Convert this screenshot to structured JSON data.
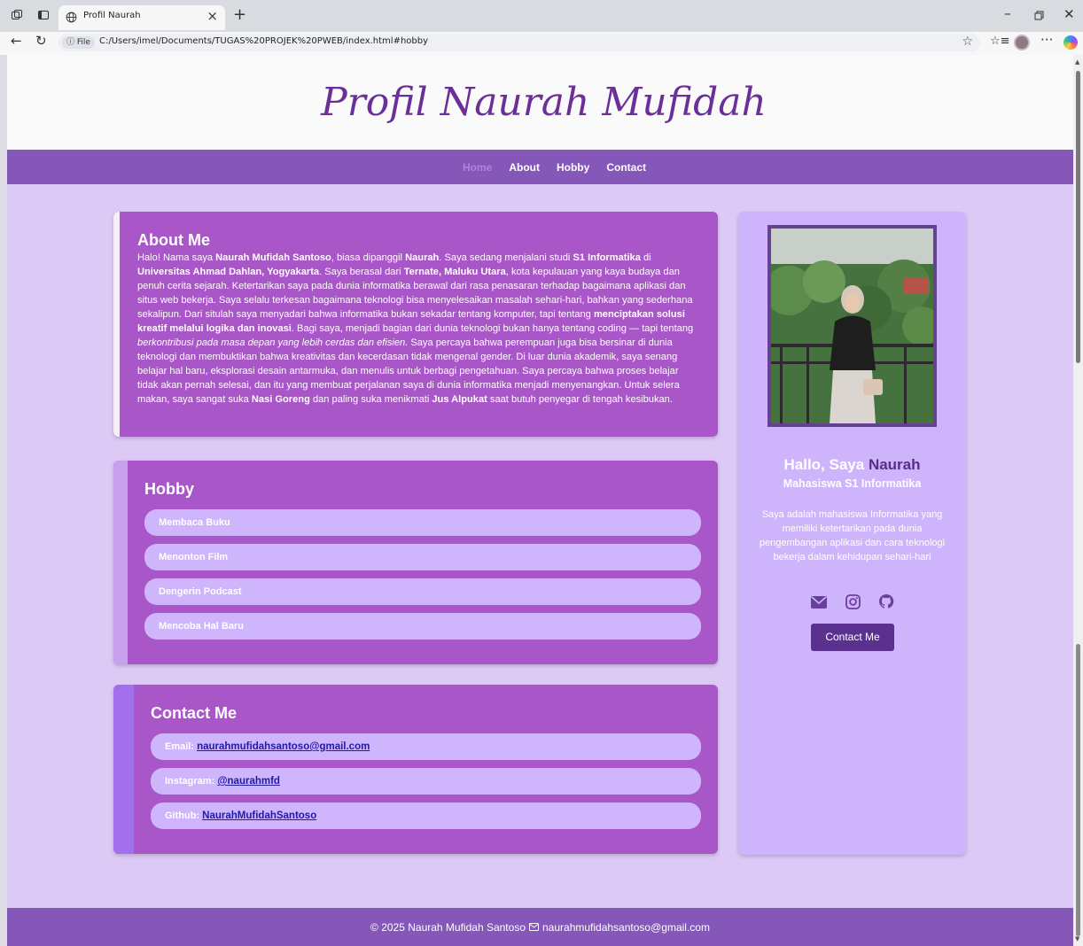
{
  "browser": {
    "tab_title": "Profil Naurah",
    "url_chip": "File",
    "url": "C:/Users/imel/Documents/TUGAS%20PROJEK%20PWEB/index.html#hobby"
  },
  "hero": {
    "title": "Profil Naurah Mufidah"
  },
  "nav": {
    "items": [
      "Home",
      "About",
      "Hobby",
      "Contact"
    ],
    "active": "Home"
  },
  "about": {
    "heading": "About Me",
    "segments": [
      {
        "t": "Halo! Nama saya "
      },
      {
        "t": "Naurah Mufidah Santoso",
        "b": true
      },
      {
        "t": ", biasa dipanggil "
      },
      {
        "t": "Naurah",
        "b": true
      },
      {
        "t": ". Saya sedang menjalani studi "
      },
      {
        "t": "S1 Informatika",
        "b": true
      },
      {
        "t": " di "
      },
      {
        "t": "Universitas Ahmad Dahlan, Yogyakarta",
        "b": true
      },
      {
        "t": ". Saya berasal dari "
      },
      {
        "t": "Ternate, Maluku Utara",
        "b": true
      },
      {
        "t": ", kota kepulauan yang kaya budaya dan penuh cerita sejarah. Ketertarikan saya pada dunia informatika berawal dari rasa penasaran terhadap bagaimana aplikasi dan situs web bekerja. Saya selalu terkesan bagaimana teknologi bisa menyelesaikan masalah sehari-hari, bahkan yang sederhana sekalipun. Dari situlah saya menyadari bahwa informatika bukan sekadar tentang komputer, tapi tentang "
      },
      {
        "t": "menciptakan solusi kreatif melalui logika dan inovasi",
        "b": true
      },
      {
        "t": ". Bagi saya, menjadi bagian dari dunia teknologi bukan hanya tentang coding — tapi tentang "
      },
      {
        "t": "berkontribusi pada masa depan yang lebih cerdas dan efisien.",
        "i": true
      },
      {
        "t": " Saya percaya bahwa perempuan juga bisa bersinar di dunia teknologi dan membuktikan bahwa kreativitas dan kecerdasan tidak mengenal gender. Di luar dunia akademik, saya senang belajar hal baru, eksplorasi desain antarmuka, dan menulis untuk berbagi pengetahuan. Saya percaya bahwa proses belajar tidak akan pernah selesai, dan itu yang membuat perjalanan saya di dunia informatika menjadi menyenangkan. Untuk selera makan, saya sangat suka "
      },
      {
        "t": "Nasi Goreng",
        "b": true
      },
      {
        "t": " dan paling suka menikmati "
      },
      {
        "t": "Jus Alpukat",
        "b": true
      },
      {
        "t": " saat butuh penyegar di tengah kesibukan."
      }
    ]
  },
  "hobby": {
    "heading": "Hobby",
    "items": [
      "Membaca Buku",
      "Menonton Film",
      "Dengerin Podcast",
      "Mencoba Hal Baru"
    ]
  },
  "contact": {
    "heading": "Contact Me",
    "items": [
      {
        "label": "Email:",
        "value": "naurahmufidahsantoso@gmail.com"
      },
      {
        "label": "Instagram:",
        "value": "@naurahmfd"
      },
      {
        "label": "Github:",
        "value": "NaurahMufidahSantoso"
      }
    ]
  },
  "profile": {
    "greeting": "Hallo, Saya",
    "name": "Naurah",
    "role": "Mahasiswa S1 Informatika",
    "bio": "Saya adalah mahasiswa Informatika yang memiliki ketertarikan pada dunia pengembangan aplikasi dan cara teknologi bekerja dalam kehidupan sehari-hari",
    "social_icons": [
      "envelope-icon",
      "instagram-icon",
      "github-icon"
    ],
    "button_label": "Contact Me"
  },
  "footer": {
    "copyright": "© 2025 Naurah Mufidah Santoso",
    "email": "naurahmufidahsantoso@gmail.com"
  },
  "colors": {
    "page_bg": "#ddc9f6",
    "nav_bg": "#8457b8",
    "card_bg": "#a956c8",
    "pill_bg": "#cfb5fb",
    "title": "#6a2f99",
    "button": "#5b3190"
  }
}
